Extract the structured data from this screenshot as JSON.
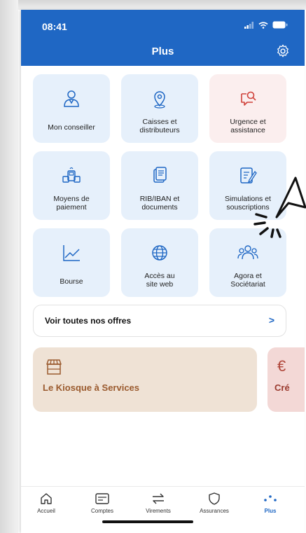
{
  "status_bar": {
    "time": "08:41"
  },
  "header": {
    "title": "Plus"
  },
  "tiles": [
    {
      "label": "Mon conseiller",
      "icon": "advisor-icon"
    },
    {
      "label": "Caisses et distributeurs",
      "label2": "distributeurs",
      "icon": "location-pin-icon"
    },
    {
      "label": "Urgence et assistance",
      "icon": "chat-search-icon"
    },
    {
      "label": "Moyens de paiement",
      "icon": "payment-terminal-icon"
    },
    {
      "label": "RIB/IBAN et documents",
      "icon": "documents-icon"
    },
    {
      "label": "Simulations et souscriptions",
      "icon": "form-edit-icon"
    },
    {
      "label": "Bourse",
      "icon": "chart-line-icon"
    },
    {
      "label": "Accès au site web",
      "icon": "globe-icon"
    },
    {
      "label": "Agora et Sociétariat",
      "icon": "group-icon"
    }
  ],
  "tile_lines": {
    "t0": [
      "Mon conseiller"
    ],
    "t1": [
      "Caisses et",
      "distributeurs"
    ],
    "t2": [
      "Urgence et",
      "assistance"
    ],
    "t3": [
      "Moyens de",
      "paiement"
    ],
    "t4": [
      "RIB/IBAN et",
      "documents"
    ],
    "t5": [
      "Simulations et",
      "souscriptions"
    ],
    "t6": [
      "Bourse"
    ],
    "t7": [
      "Accès au",
      "site web"
    ],
    "t8": [
      "Agora et",
      "Sociétariat"
    ]
  },
  "offers": {
    "label": "Voir toutes nos offres",
    "chevron": ">"
  },
  "cards": [
    {
      "title": "Le Kiosque à Services",
      "icon": "shop-icon"
    },
    {
      "title": "Cré",
      "icon": "euro-icon"
    }
  ],
  "nav": [
    {
      "label": "Accueil",
      "icon": "home-icon"
    },
    {
      "label": "Comptes",
      "icon": "card-icon"
    },
    {
      "label": "Virements",
      "icon": "transfer-icon"
    },
    {
      "label": "Assurances",
      "icon": "shield-icon"
    },
    {
      "label": "Plus",
      "icon": "more-dots-icon",
      "active": true
    }
  ],
  "colors": {
    "accent": "#1f67c4",
    "tile_bg": "#e6f0fb",
    "alert_tile_bg": "#fbeeee",
    "alert": "#d0413a"
  }
}
